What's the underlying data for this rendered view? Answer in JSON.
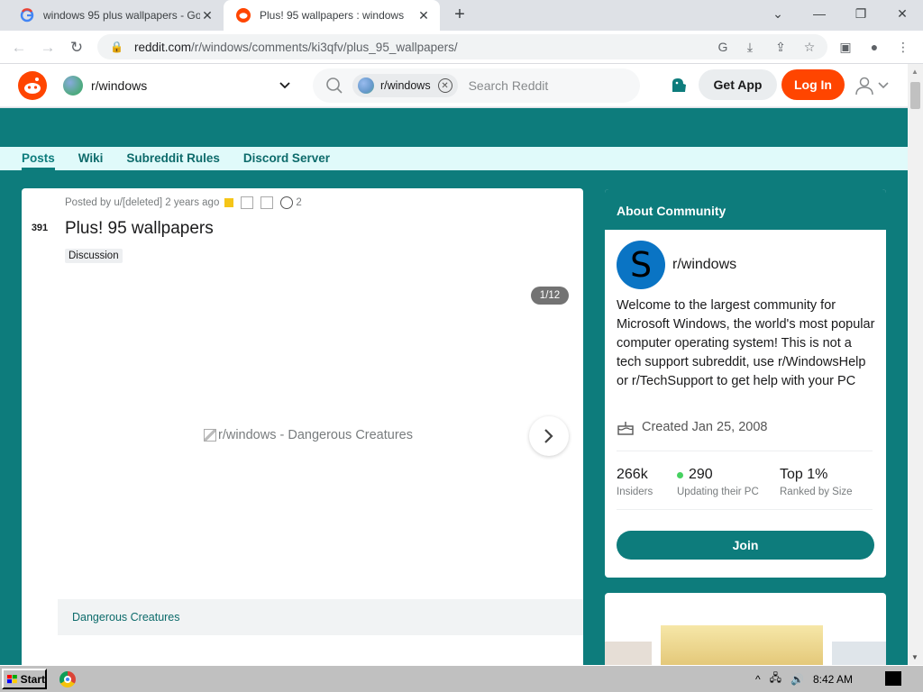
{
  "browser": {
    "tabs": [
      {
        "title": "windows 95 plus wallpapers - Goo",
        "active": false,
        "favicon": "google-g"
      },
      {
        "title": "Plus! 95 wallpapers : windows",
        "active": true,
        "favicon": "reddit"
      }
    ],
    "url_host": "reddit.com",
    "url_path": "/r/windows/comments/ki3qfv/plus_95_wallpapers/"
  },
  "reddit_header": {
    "community": "r/windows",
    "search_chip": "r/windows",
    "search_placeholder": "Search Reddit",
    "get_app": "Get App",
    "log_in": "Log In"
  },
  "subnav": [
    "Posts",
    "Wiki",
    "Subreddit Rules",
    "Discord Server"
  ],
  "post": {
    "votes": "391",
    "posted_by": "Posted by u/[deleted] 2 years ago",
    "award_count": "2",
    "title": "Plus! 95 wallpapers",
    "flair": "Discussion",
    "gallery_counter": "1/12",
    "image_alt": "r/windows - Dangerous Creatures",
    "caption": "Dangerous Creatures"
  },
  "about": {
    "heading": "About Community",
    "name": "r/windows",
    "description": "Welcome to the largest community for Microsoft Windows, the world's most popular computer operating system! This is not a tech support subreddit, use r/WindowsHelp or r/TechSupport to get help with your PC",
    "created": "Created Jan 25, 2008",
    "stats": [
      {
        "value": "266k",
        "label": "Insiders"
      },
      {
        "value": "290",
        "label": "Updating their PC"
      },
      {
        "value": "Top 1%",
        "label": "Ranked by Size"
      }
    ],
    "join": "Join"
  },
  "taskbar": {
    "start": "Start",
    "clock": "8:42 AM"
  },
  "colors": {
    "theme": "#0d7c7c",
    "reddit_orange": "#ff4500",
    "online_dot": "#46d160"
  }
}
